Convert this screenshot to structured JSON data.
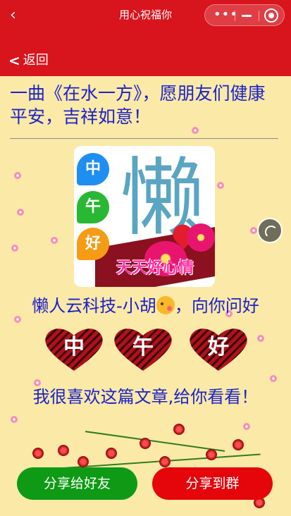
{
  "topbar": {
    "title": "用心祝福你",
    "back_icon": "chevron-left-icon",
    "more_icon": "more-dots-icon",
    "minimize_icon": "minus-icon",
    "close_icon": "target-icon"
  },
  "subbar": {
    "back_label": "返回"
  },
  "content": {
    "headline": "一曲《在水一方》，愿朋友们健康平安，吉祥如意！",
    "image": {
      "bubbles": [
        "中",
        "午",
        "好"
      ],
      "big_char": "懒",
      "greeting": "天天好心情"
    },
    "sender_prefix": "懒人云科技-小胡",
    "sender_suffix": "，向你问好",
    "hearts": [
      "中",
      "午",
      "好"
    ],
    "message": "我很喜欢这篇文章,给你看看！"
  },
  "actions": {
    "share_friend": "分享给好友",
    "share_group": "分享到群"
  },
  "colors": {
    "header_red": "#d8141c",
    "text_blue": "#1a22c8",
    "background": "#fbe9a8",
    "button_green": "#0e9a14",
    "button_red": "#e4060a"
  }
}
